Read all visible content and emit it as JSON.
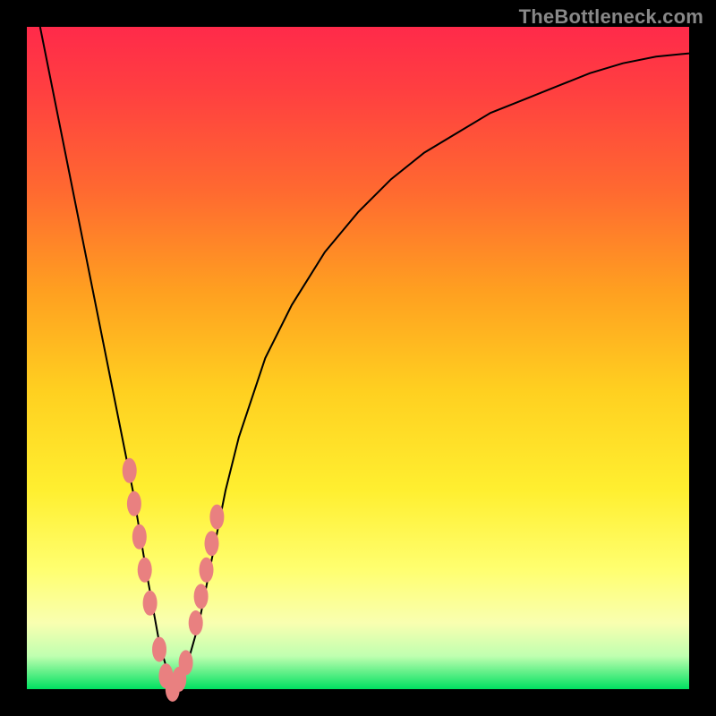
{
  "watermark": "TheBottleneck.com",
  "colors": {
    "background": "#000000",
    "marker": "#e98080",
    "curve": "#000000",
    "gradient_top": "#ff2a4a",
    "gradient_bottom": "#00e060"
  },
  "chart_data": {
    "type": "line",
    "title": "",
    "xlabel": "",
    "ylabel": "",
    "xlim": [
      0,
      100
    ],
    "ylim": [
      0,
      100
    ],
    "x_of_minimum": 22,
    "series": [
      {
        "name": "bottleneck-curve",
        "x": [
          2,
          4,
          6,
          8,
          10,
          12,
          14,
          16,
          18,
          20,
          22,
          24,
          26,
          28,
          30,
          32,
          36,
          40,
          45,
          50,
          55,
          60,
          65,
          70,
          75,
          80,
          85,
          90,
          95,
          100
        ],
        "y": [
          100,
          90,
          80,
          70,
          60,
          50,
          40,
          30,
          18,
          7,
          0,
          3,
          10,
          20,
          30,
          38,
          50,
          58,
          66,
          72,
          77,
          81,
          84,
          87,
          89,
          91,
          93,
          94.5,
          95.5,
          96
        ]
      }
    ],
    "markers": {
      "name": "highlighted-points",
      "x": [
        15.5,
        16.2,
        17.0,
        17.8,
        18.6,
        20.0,
        21.0,
        22.0,
        23.0,
        24.0,
        25.5,
        26.3,
        27.1,
        27.9,
        28.7
      ],
      "y": [
        33,
        28,
        23,
        18,
        13,
        6,
        2,
        0,
        1.5,
        4,
        10,
        14,
        18,
        22,
        26
      ]
    }
  }
}
